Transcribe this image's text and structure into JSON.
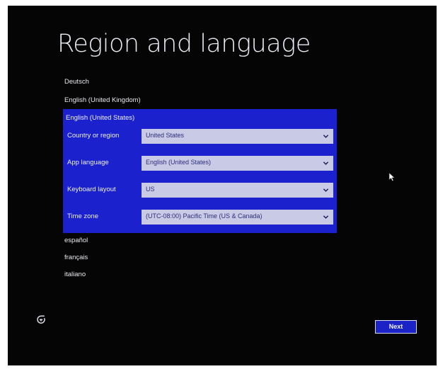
{
  "page": {
    "title": "Region and language"
  },
  "languages": {
    "above": [
      "Deutsch",
      "English (United Kingdom)"
    ],
    "selected": "English (United States)",
    "below": [
      "español",
      "français",
      "italiano"
    ]
  },
  "fields": {
    "country": {
      "label": "Country or region",
      "value": "United States"
    },
    "app_language": {
      "label": "App language",
      "value": "English (United States)"
    },
    "keyboard": {
      "label": "Keyboard layout",
      "value": "US"
    },
    "timezone": {
      "label": "Time zone",
      "value": "(UTC-08:00) Pacific Time (US & Canada)"
    }
  },
  "buttons": {
    "next_label": "Next"
  },
  "icons": {
    "ease_of_access": "ease-of-access-icon",
    "chevron": "chevron-down-icon",
    "cursor": "mouse-pointer-icon"
  },
  "colors": {
    "background": "#050506",
    "accent": "#1b21cc",
    "select_bg": "#c9cae6",
    "text": "#e9ebf2"
  }
}
